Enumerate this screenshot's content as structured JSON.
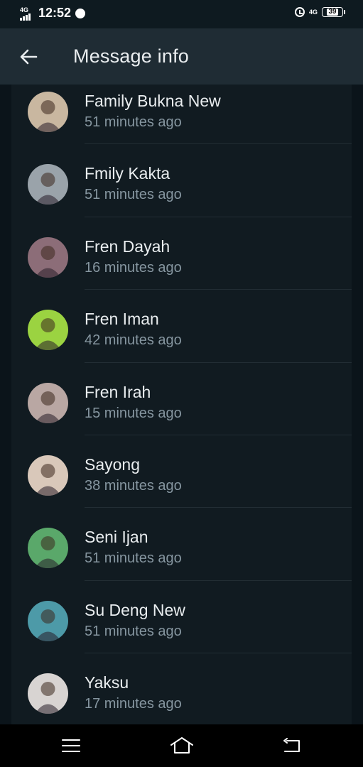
{
  "status_bar": {
    "network": "4G",
    "time": "12:52",
    "right_network": "4G",
    "battery": "39"
  },
  "app_bar": {
    "back_icon": "arrow-left-icon",
    "title": "Message info"
  },
  "contacts": [
    {
      "name": "Family Bukna New",
      "time": "51 minutes ago",
      "avatar_color": "#c9b7a0"
    },
    {
      "name": "Fmily Kakta",
      "time": "51 minutes ago",
      "avatar_color": "#9aa3aa"
    },
    {
      "name": "Fren Dayah",
      "time": "16 minutes ago",
      "avatar_color": "#8c6d78"
    },
    {
      "name": "Fren Iman",
      "time": "42 minutes ago",
      "avatar_color": "#9bd341"
    },
    {
      "name": "Fren Irah",
      "time": "15 minutes ago",
      "avatar_color": "#b9a7a3"
    },
    {
      "name": "Sayong",
      "time": "38 minutes ago",
      "avatar_color": "#d9c8ba"
    },
    {
      "name": "Seni Ijan",
      "time": "51 minutes ago",
      "avatar_color": "#5aa86a"
    },
    {
      "name": "Su Deng New",
      "time": "51 minutes ago",
      "avatar_color": "#4d9aa8"
    },
    {
      "name": "Yaksu",
      "time": "17 minutes ago",
      "avatar_color": "#d8d4d2"
    }
  ],
  "nav_bar": {
    "menu_icon": "menu-icon",
    "home_icon": "home-icon",
    "back_icon": "back-icon"
  },
  "colors": {
    "background": "#111b21",
    "app_bar": "#1f2c34",
    "primary_text": "#e9edef",
    "secondary_text": "#8696a0"
  }
}
